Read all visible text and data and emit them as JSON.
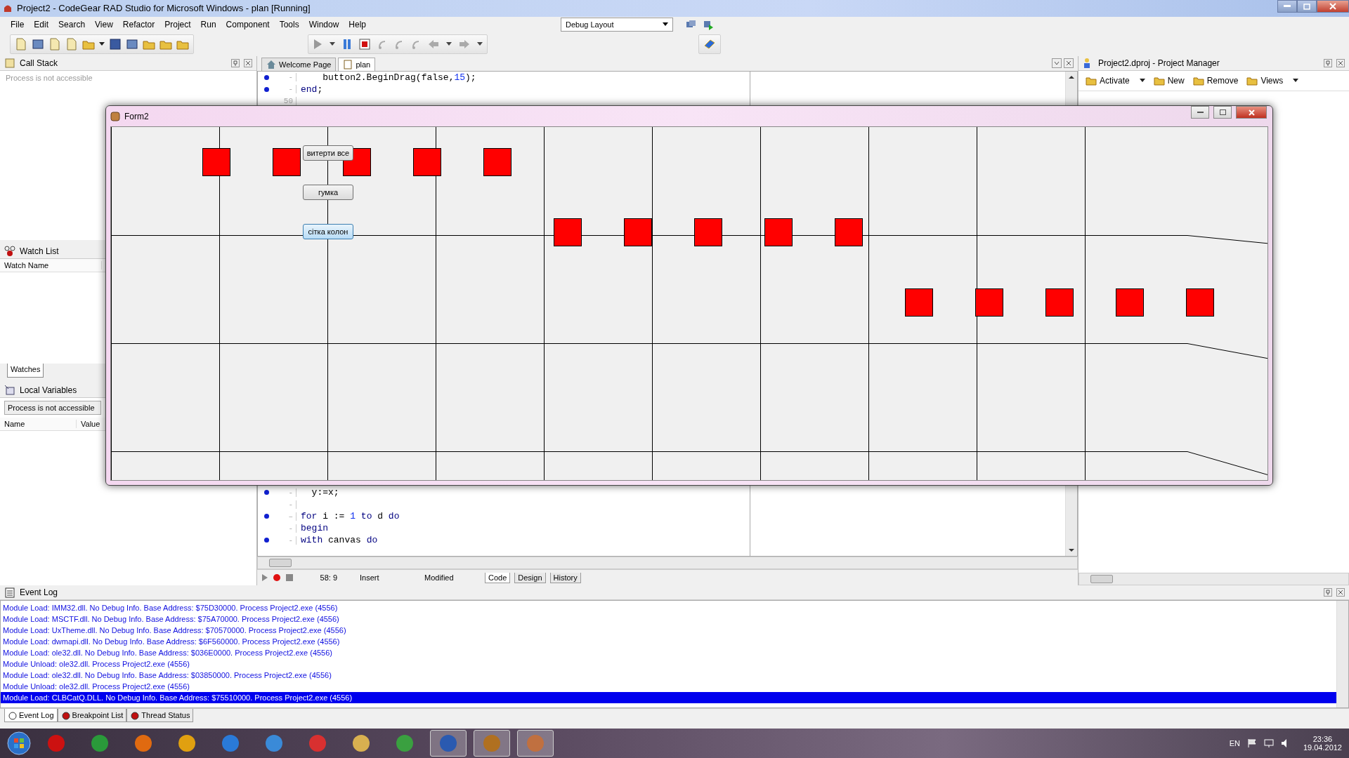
{
  "window": {
    "title": "Project2 - CodeGear RAD Studio for Microsoft Windows - plan [Running]"
  },
  "menu": [
    "File",
    "Edit",
    "Search",
    "View",
    "Refactor",
    "Project",
    "Run",
    "Component",
    "Tools",
    "Window",
    "Help"
  ],
  "layout_combo": {
    "value": "Debug Layout"
  },
  "call_stack": {
    "title": "Call Stack",
    "message": "Process is not accessible"
  },
  "watch_list": {
    "title": "Watch List",
    "columns": [
      "Watch Name"
    ],
    "tabs": [
      {
        "label": "Watches",
        "selected": true
      }
    ]
  },
  "local_variables": {
    "title": "Local Variables",
    "combo": "Process is not accessible",
    "columns": [
      "Name",
      "Value"
    ]
  },
  "editor": {
    "tabs": [
      {
        "label": "Welcome Page",
        "selected": false
      },
      {
        "label": "plan",
        "selected": true
      }
    ],
    "top_lines": [
      {
        "dot": true,
        "number": "-",
        "segments": [
          {
            "kind": "plain",
            "text": "    button2.BeginDrag(false,"
          },
          {
            "kind": "number",
            "text": "15"
          },
          {
            "kind": "plain",
            "text": ");"
          }
        ]
      },
      {
        "dot": true,
        "number": "-",
        "segments": [
          {
            "kind": "keyword",
            "text": "end"
          },
          {
            "kind": "plain",
            "text": ";"
          }
        ]
      },
      {
        "dot": false,
        "number": "50"
      }
    ],
    "bottom_lines": [
      {
        "dot": true,
        "number": "-",
        "segments": [
          {
            "kind": "plain",
            "text": "  y:=x;"
          }
        ]
      },
      {
        "dot": false,
        "number": "-"
      },
      {
        "dot": true,
        "number": "–",
        "segments": [
          {
            "kind": "keyword",
            "text": "for"
          },
          {
            "kind": "plain",
            "text": " i := "
          },
          {
            "kind": "number",
            "text": "1"
          },
          {
            "kind": "keyword",
            "text": " to"
          },
          {
            "kind": "plain",
            "text": " d "
          },
          {
            "kind": "keyword",
            "text": "do"
          }
        ]
      },
      {
        "dot": false,
        "number": "-",
        "segments": [
          {
            "kind": "keyword",
            "text": "begin"
          }
        ]
      },
      {
        "dot": true,
        "number": "-",
        "segments": [
          {
            "kind": "keyword",
            "text": "with"
          },
          {
            "kind": "plain",
            "text": " canvas "
          },
          {
            "kind": "keyword",
            "text": "do"
          }
        ]
      }
    ],
    "status": {
      "position": "58: 9",
      "mode": "Insert",
      "state": "Modified"
    },
    "view_tabs": [
      {
        "label": "Code",
        "selected": true
      },
      {
        "label": "Design",
        "selected": false
      },
      {
        "label": "History",
        "selected": false
      }
    ]
  },
  "project_manager": {
    "title": "Project2.dproj - Project Manager",
    "tools": [
      {
        "label": "Activate",
        "dropdown": true
      },
      {
        "label": "New",
        "dropdown": false
      },
      {
        "label": "Remove",
        "dropdown": false
      },
      {
        "label": "Views",
        "dropdown": true
      }
    ]
  },
  "event_log": {
    "title": "Event Log",
    "rows": [
      {
        "text": "Module Load: IMM32.dll. No Debug Info. Base Address: $75D30000. Process Project2.exe (4556)",
        "selected": false
      },
      {
        "text": "Module Load: MSCTF.dll. No Debug Info. Base Address: $75A70000. Process Project2.exe (4556)",
        "selected": false
      },
      {
        "text": "Module Load: UxTheme.dll. No Debug Info. Base Address: $70570000. Process Project2.exe (4556)",
        "selected": false
      },
      {
        "text": "Module Load: dwmapi.dll. No Debug Info. Base Address: $6F560000. Process Project2.exe (4556)",
        "selected": false
      },
      {
        "text": "Module Load: ole32.dll. No Debug Info. Base Address: $036E0000. Process Project2.exe (4556)",
        "selected": false
      },
      {
        "text": "Module Unload: ole32.dll. Process Project2.exe (4556)",
        "selected": false
      },
      {
        "text": "Module Load: ole32.dll. No Debug Info. Base Address: $03850000. Process Project2.exe (4556)",
        "selected": false
      },
      {
        "text": "Module Unload: ole32.dll. Process Project2.exe (4556)",
        "selected": false
      },
      {
        "text": "Module Load: CLBCatQ.DLL. No Debug Info. Base Address: $75510000. Process Project2.exe (4556)",
        "selected": true
      }
    ],
    "tabs": [
      {
        "label": "Event Log",
        "selected": true
      },
      {
        "label": "Breakpoint List",
        "selected": false
      },
      {
        "label": "Thread Status",
        "selected": false
      }
    ]
  },
  "form2": {
    "title": "Form2",
    "buttons": [
      {
        "label": "витерти все",
        "focused": false
      },
      {
        "label": "гумка",
        "focused": false
      },
      {
        "label": "сітка колон",
        "focused": true
      }
    ]
  },
  "taskbar": {
    "apps": [
      {
        "active": false
      },
      {
        "active": false
      },
      {
        "active": false
      },
      {
        "active": false
      },
      {
        "active": false
      },
      {
        "active": false
      },
      {
        "active": false
      },
      {
        "active": false
      },
      {
        "active": false
      },
      {
        "active": true
      },
      {
        "active": true
      },
      {
        "active": true
      }
    ],
    "language": "EN",
    "time": "23:36",
    "date": "19.04.2012"
  }
}
